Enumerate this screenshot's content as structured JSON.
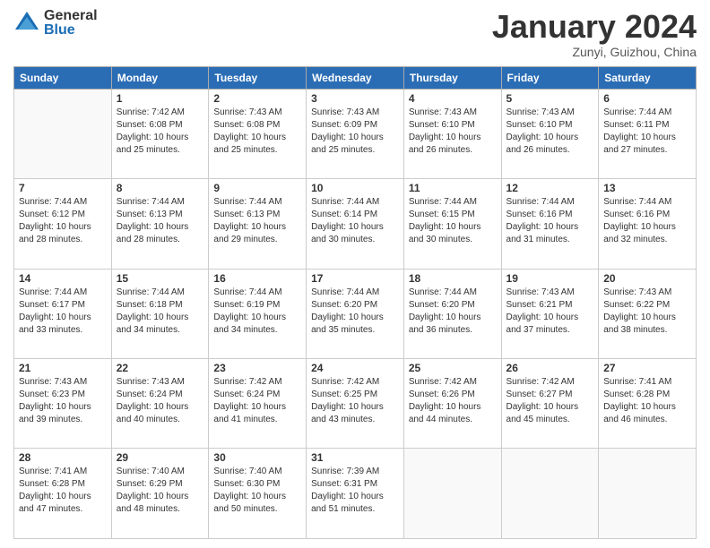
{
  "header": {
    "logo_general": "General",
    "logo_blue": "Blue",
    "month_title": "January 2024",
    "location": "Zunyi, Guizhou, China"
  },
  "days_of_week": [
    "Sunday",
    "Monday",
    "Tuesday",
    "Wednesday",
    "Thursday",
    "Friday",
    "Saturday"
  ],
  "weeks": [
    [
      {
        "num": "",
        "info": ""
      },
      {
        "num": "1",
        "info": "Sunrise: 7:42 AM\nSunset: 6:08 PM\nDaylight: 10 hours\nand 25 minutes."
      },
      {
        "num": "2",
        "info": "Sunrise: 7:43 AM\nSunset: 6:08 PM\nDaylight: 10 hours\nand 25 minutes."
      },
      {
        "num": "3",
        "info": "Sunrise: 7:43 AM\nSunset: 6:09 PM\nDaylight: 10 hours\nand 25 minutes."
      },
      {
        "num": "4",
        "info": "Sunrise: 7:43 AM\nSunset: 6:10 PM\nDaylight: 10 hours\nand 26 minutes."
      },
      {
        "num": "5",
        "info": "Sunrise: 7:43 AM\nSunset: 6:10 PM\nDaylight: 10 hours\nand 26 minutes."
      },
      {
        "num": "6",
        "info": "Sunrise: 7:44 AM\nSunset: 6:11 PM\nDaylight: 10 hours\nand 27 minutes."
      }
    ],
    [
      {
        "num": "7",
        "info": "Sunrise: 7:44 AM\nSunset: 6:12 PM\nDaylight: 10 hours\nand 28 minutes."
      },
      {
        "num": "8",
        "info": "Sunrise: 7:44 AM\nSunset: 6:13 PM\nDaylight: 10 hours\nand 28 minutes."
      },
      {
        "num": "9",
        "info": "Sunrise: 7:44 AM\nSunset: 6:13 PM\nDaylight: 10 hours\nand 29 minutes."
      },
      {
        "num": "10",
        "info": "Sunrise: 7:44 AM\nSunset: 6:14 PM\nDaylight: 10 hours\nand 30 minutes."
      },
      {
        "num": "11",
        "info": "Sunrise: 7:44 AM\nSunset: 6:15 PM\nDaylight: 10 hours\nand 30 minutes."
      },
      {
        "num": "12",
        "info": "Sunrise: 7:44 AM\nSunset: 6:16 PM\nDaylight: 10 hours\nand 31 minutes."
      },
      {
        "num": "13",
        "info": "Sunrise: 7:44 AM\nSunset: 6:16 PM\nDaylight: 10 hours\nand 32 minutes."
      }
    ],
    [
      {
        "num": "14",
        "info": "Sunrise: 7:44 AM\nSunset: 6:17 PM\nDaylight: 10 hours\nand 33 minutes."
      },
      {
        "num": "15",
        "info": "Sunrise: 7:44 AM\nSunset: 6:18 PM\nDaylight: 10 hours\nand 34 minutes."
      },
      {
        "num": "16",
        "info": "Sunrise: 7:44 AM\nSunset: 6:19 PM\nDaylight: 10 hours\nand 34 minutes."
      },
      {
        "num": "17",
        "info": "Sunrise: 7:44 AM\nSunset: 6:20 PM\nDaylight: 10 hours\nand 35 minutes."
      },
      {
        "num": "18",
        "info": "Sunrise: 7:44 AM\nSunset: 6:20 PM\nDaylight: 10 hours\nand 36 minutes."
      },
      {
        "num": "19",
        "info": "Sunrise: 7:43 AM\nSunset: 6:21 PM\nDaylight: 10 hours\nand 37 minutes."
      },
      {
        "num": "20",
        "info": "Sunrise: 7:43 AM\nSunset: 6:22 PM\nDaylight: 10 hours\nand 38 minutes."
      }
    ],
    [
      {
        "num": "21",
        "info": "Sunrise: 7:43 AM\nSunset: 6:23 PM\nDaylight: 10 hours\nand 39 minutes."
      },
      {
        "num": "22",
        "info": "Sunrise: 7:43 AM\nSunset: 6:24 PM\nDaylight: 10 hours\nand 40 minutes."
      },
      {
        "num": "23",
        "info": "Sunrise: 7:42 AM\nSunset: 6:24 PM\nDaylight: 10 hours\nand 41 minutes."
      },
      {
        "num": "24",
        "info": "Sunrise: 7:42 AM\nSunset: 6:25 PM\nDaylight: 10 hours\nand 43 minutes."
      },
      {
        "num": "25",
        "info": "Sunrise: 7:42 AM\nSunset: 6:26 PM\nDaylight: 10 hours\nand 44 minutes."
      },
      {
        "num": "26",
        "info": "Sunrise: 7:42 AM\nSunset: 6:27 PM\nDaylight: 10 hours\nand 45 minutes."
      },
      {
        "num": "27",
        "info": "Sunrise: 7:41 AM\nSunset: 6:28 PM\nDaylight: 10 hours\nand 46 minutes."
      }
    ],
    [
      {
        "num": "28",
        "info": "Sunrise: 7:41 AM\nSunset: 6:28 PM\nDaylight: 10 hours\nand 47 minutes."
      },
      {
        "num": "29",
        "info": "Sunrise: 7:40 AM\nSunset: 6:29 PM\nDaylight: 10 hours\nand 48 minutes."
      },
      {
        "num": "30",
        "info": "Sunrise: 7:40 AM\nSunset: 6:30 PM\nDaylight: 10 hours\nand 50 minutes."
      },
      {
        "num": "31",
        "info": "Sunrise: 7:39 AM\nSunset: 6:31 PM\nDaylight: 10 hours\nand 51 minutes."
      },
      {
        "num": "",
        "info": ""
      },
      {
        "num": "",
        "info": ""
      },
      {
        "num": "",
        "info": ""
      }
    ]
  ]
}
